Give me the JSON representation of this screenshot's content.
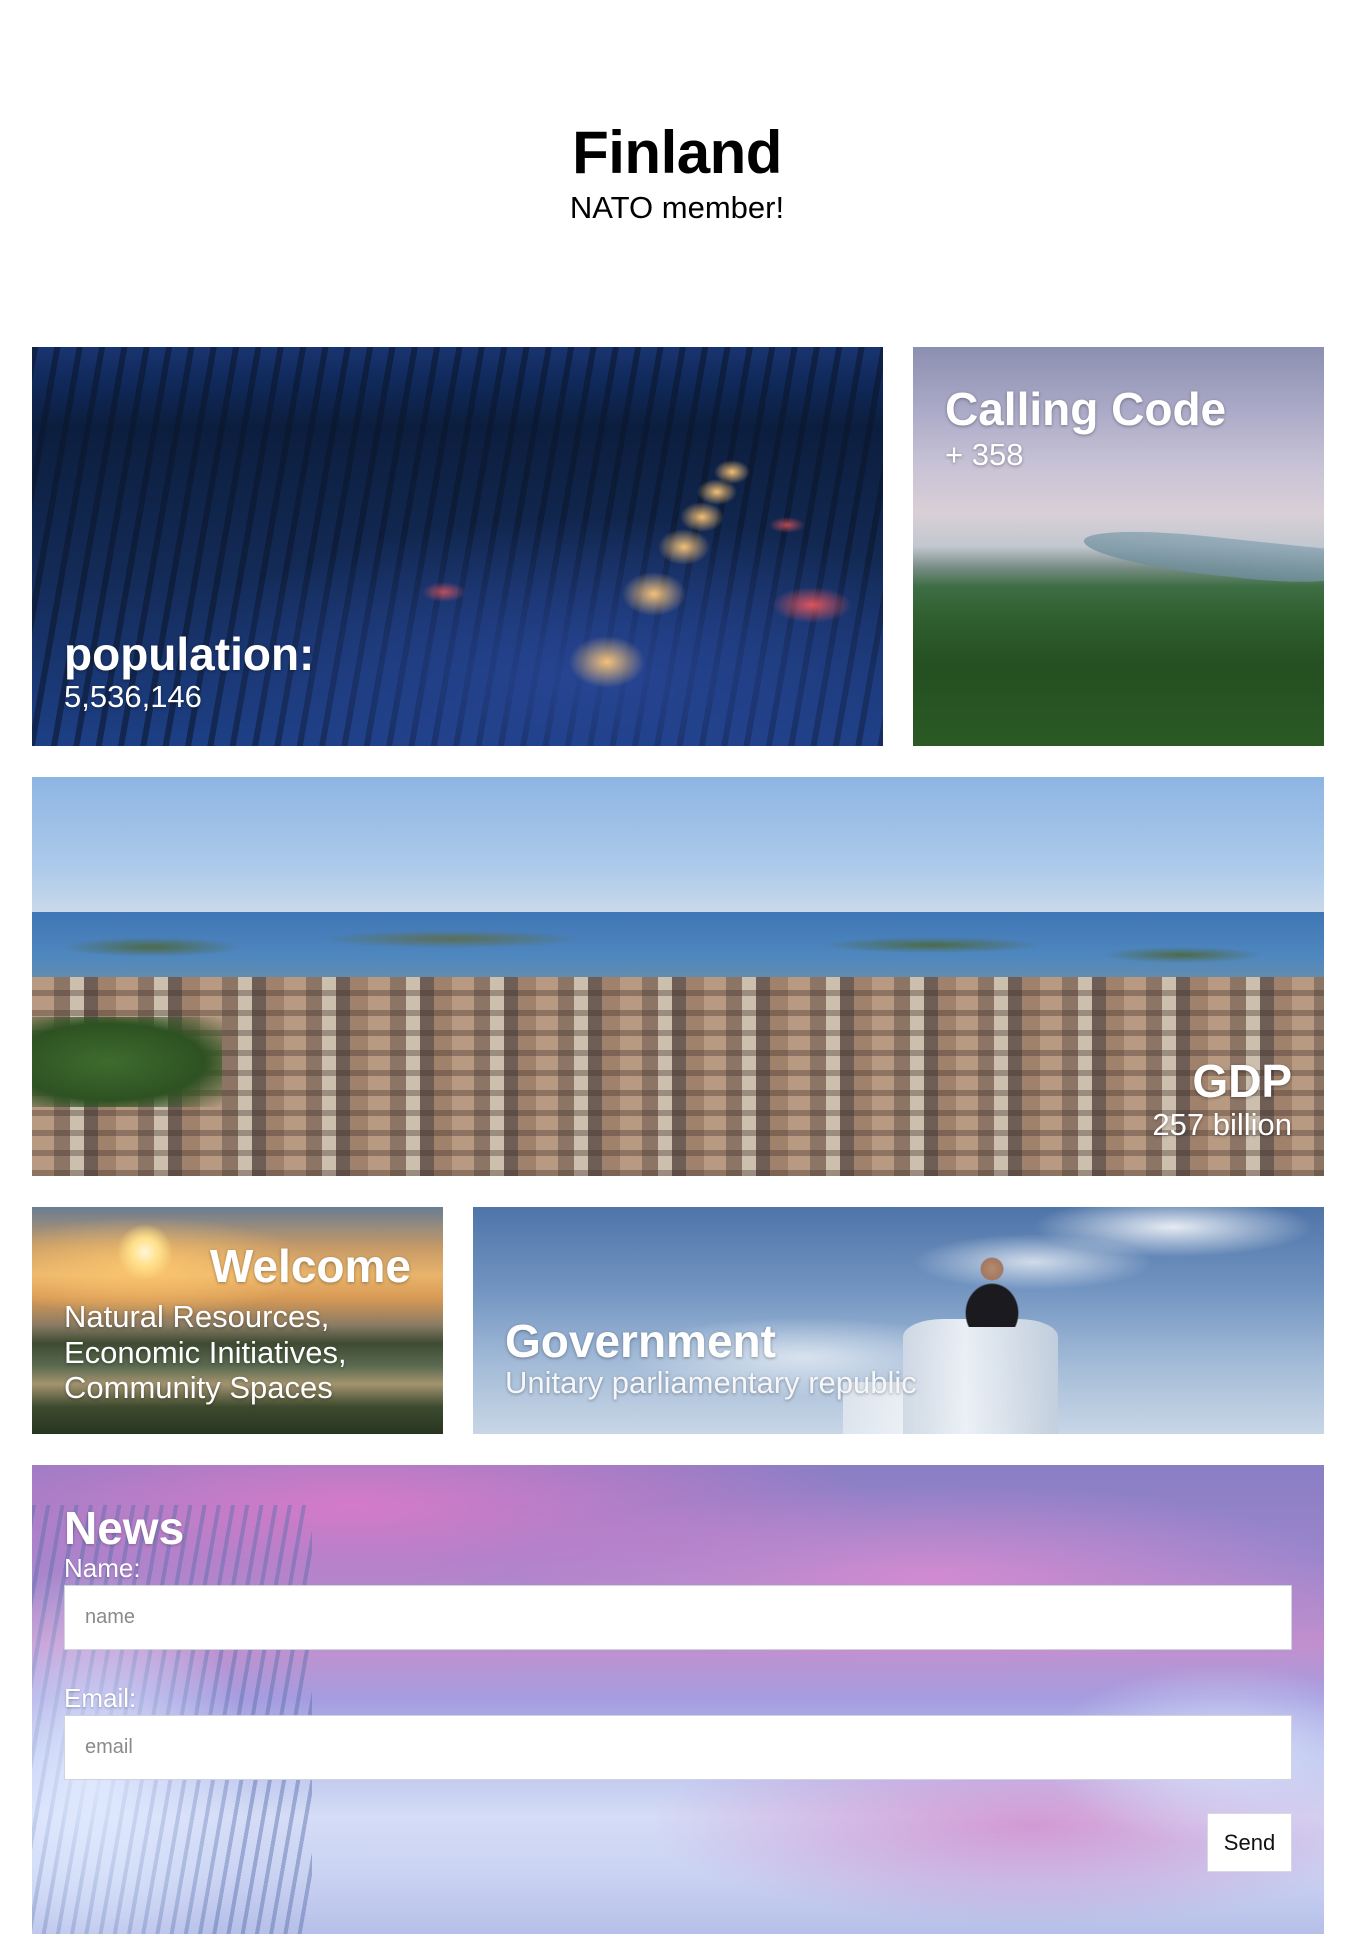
{
  "header": {
    "title": "Finland",
    "subtitle": "NATO member!"
  },
  "cards": {
    "population": {
      "title": "population:",
      "value": "5,536,146"
    },
    "calling_code": {
      "title": "Calling Code",
      "value": "+ 358"
    },
    "gdp": {
      "title": "GDP",
      "value": "257 billion"
    },
    "welcome": {
      "title": "Welcome",
      "lines": [
        "Natural Resources,",
        "Economic Initiatives,",
        "Community Spaces"
      ]
    },
    "government": {
      "title": "Government",
      "value": "Unitary parliamentary republic"
    }
  },
  "news_form": {
    "title": "News",
    "name_label": "Name:",
    "name_placeholder": "name",
    "email_label": "Email:",
    "email_placeholder": "email",
    "send_label": "Send"
  }
}
